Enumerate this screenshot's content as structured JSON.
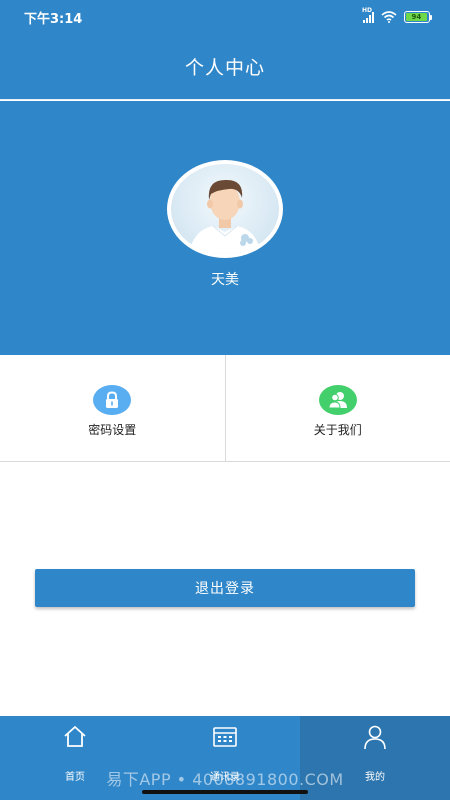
{
  "status_bar": {
    "time": "下午3:14",
    "hd_label": "HD",
    "battery_level": "94",
    "icons": [
      "signal-icon",
      "wifi-icon",
      "battery-icon"
    ]
  },
  "header": {
    "title": "个人中心"
  },
  "profile": {
    "name": "天美",
    "avatar_icon": "user-avatar"
  },
  "menu": {
    "items": [
      {
        "label": "密码设置",
        "icon": "lock-icon",
        "color": "#58aef0"
      },
      {
        "label": "关于我们",
        "icon": "users-icon",
        "color": "#44cf6d"
      }
    ]
  },
  "logout": {
    "label": "退出登录"
  },
  "tab_bar": {
    "items": [
      {
        "label": "首页",
        "icon": "home-icon"
      },
      {
        "label": "通讯录",
        "icon": "contacts-icon"
      },
      {
        "label": "我的",
        "icon": "profile-icon",
        "active": true
      }
    ]
  },
  "watermark": "易下APP • 4008891800.COM",
  "colors": {
    "primary": "#2f86c8",
    "active_tab": "#2c75ae",
    "battery": "#6ed84a"
  }
}
